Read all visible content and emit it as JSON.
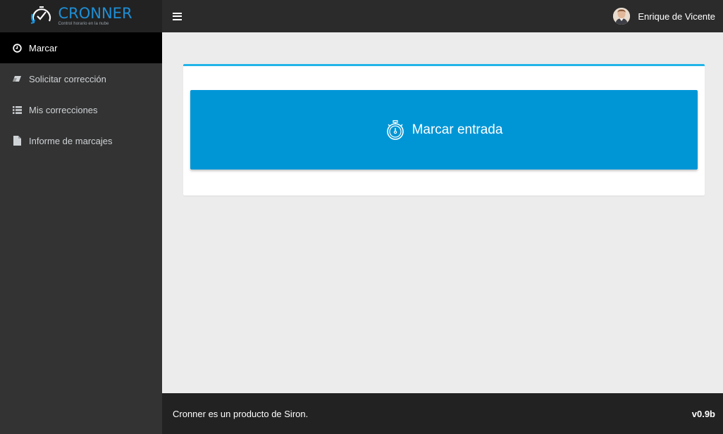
{
  "brand": {
    "name": "CRONNER",
    "tagline": "Control horario en la nube",
    "accent_color": "#1e8fd6"
  },
  "sidebar": {
    "items": [
      {
        "label": "Marcar",
        "icon": "clock-icon",
        "active": true
      },
      {
        "label": "Solicitar corrección",
        "icon": "eraser-icon",
        "active": false
      },
      {
        "label": "Mis correcciones",
        "icon": "list-icon",
        "active": false
      },
      {
        "label": "Informe de marcajes",
        "icon": "file-icon",
        "active": false
      }
    ]
  },
  "header": {
    "menu_icon": "hamburger-icon",
    "user_name": "Enrique de Vicente"
  },
  "main": {
    "clock_button_label": "Marcar entrada",
    "clock_button_icon": "stopwatch-icon",
    "button_color": "#0096d6",
    "box_accent_color": "#22b4e8"
  },
  "footer": {
    "text": "Cronner es un producto de Siron.",
    "version": "v0.9b"
  }
}
